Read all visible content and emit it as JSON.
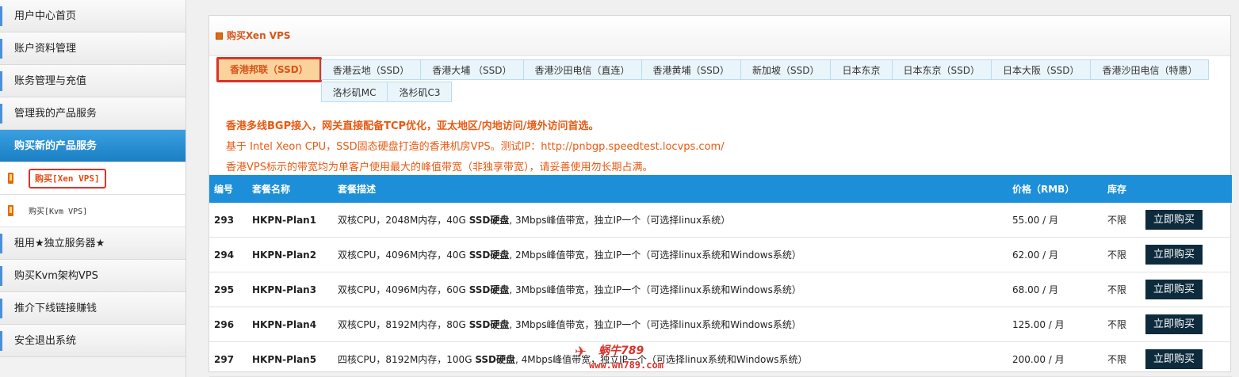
{
  "sidebar": {
    "items": [
      {
        "label": "用户中心首页"
      },
      {
        "label": "账户资料管理"
      },
      {
        "label": "账务管理与充值"
      },
      {
        "label": "管理我的产品服务"
      },
      {
        "label": "购买新的产品服务"
      }
    ],
    "sub_items": [
      {
        "label": "购买[Xen VPS]"
      },
      {
        "label": "购买[Kvm VPS]"
      }
    ],
    "items_after": [
      {
        "label": "租用★独立服务器★"
      },
      {
        "label": "购买Kvm架构VPS"
      },
      {
        "label": "推介下线链接赚钱"
      },
      {
        "label": "安全退出系统"
      }
    ]
  },
  "panel": {
    "title": "购买Xen VPS"
  },
  "tabs": [
    "香港邦联（SSD）",
    "香港云地（SSD）",
    "香港大埔 （SSD）",
    "香港沙田电信（直连）",
    "香港黄埔（SSD）",
    "新加坡（SSD）",
    "日本东京",
    "日本东京（SSD）",
    "日本大阪（SSD）",
    "香港沙田电信（特惠）",
    "洛杉矶MC",
    "洛杉矶C3"
  ],
  "intro": {
    "line1": "香港多线BGP接入，网关直接配备TCP优化，亚太地区/内地访问/境外访问首选。",
    "line2": "基于 Intel Xeon CPU，SSD固态硬盘打造的香港机房VPS。测试IP：http://pnbgp.speedtest.locvps.com/",
    "line3": "香港VPS标示的带宽均为单客户使用最大的峰值带宽（非独享带宽），请妥善使用勿长期占满。"
  },
  "table": {
    "headers": {
      "id": "编号",
      "name": "套餐名称",
      "desc": "套餐描述",
      "price": "价格（RMB）",
      "stock": "库存"
    },
    "buy_label": "立即购买",
    "rows": [
      {
        "id": "293",
        "name": "HKPN-Plan1",
        "desc_a": "双核CPU，2048M内存，40G ",
        "desc_b": "SSD硬盘",
        "desc_c": ", 3Mbps峰值带宽，独立IP一个（可选择linux系统）",
        "price": "55.00 / 月",
        "stock": "不限"
      },
      {
        "id": "294",
        "name": "HKPN-Plan2",
        "desc_a": "双核CPU，4096M内存，40G ",
        "desc_b": "SSD硬盘",
        "desc_c": ", 2Mbps峰值带宽，独立IP一个（可选择linux系统和Windows系统）",
        "price": "62.00 / 月",
        "stock": "不限"
      },
      {
        "id": "295",
        "name": "HKPN-Plan3",
        "desc_a": "双核CPU，4096M内存，60G ",
        "desc_b": "SSD硬盘",
        "desc_c": ", 3Mbps峰值带宽，独立IP一个（可选择linux系统和Windows系统）",
        "price": "68.00 / 月",
        "stock": "不限"
      },
      {
        "id": "296",
        "name": "HKPN-Plan4",
        "desc_a": "双核CPU，8192M内存，80G ",
        "desc_b": "SSD硬盘",
        "desc_c": ", 3Mbps峰值带宽，独立IP一个（可选择linux系统和Windows系统）",
        "price": "125.00 / 月",
        "stock": "不限"
      },
      {
        "id": "297",
        "name": "HKPN-Plan5",
        "desc_a": "四核CPU，8192M内存，100G ",
        "desc_b": "SSD硬盘",
        "desc_c": ", 4Mbps峰值带宽，独立IP一个（可选择linux系统和Windows系统）",
        "price": "200.00 / 月",
        "stock": "不限"
      }
    ]
  },
  "watermark": {
    "top": "蜗牛789",
    "bottom": "www.wn789.com"
  },
  "colors": {
    "accent_orange": "#e85a12",
    "header_blue": "#1c8fd8",
    "button_dark": "#0d2b3c",
    "highlight_red": "#d9332b"
  }
}
